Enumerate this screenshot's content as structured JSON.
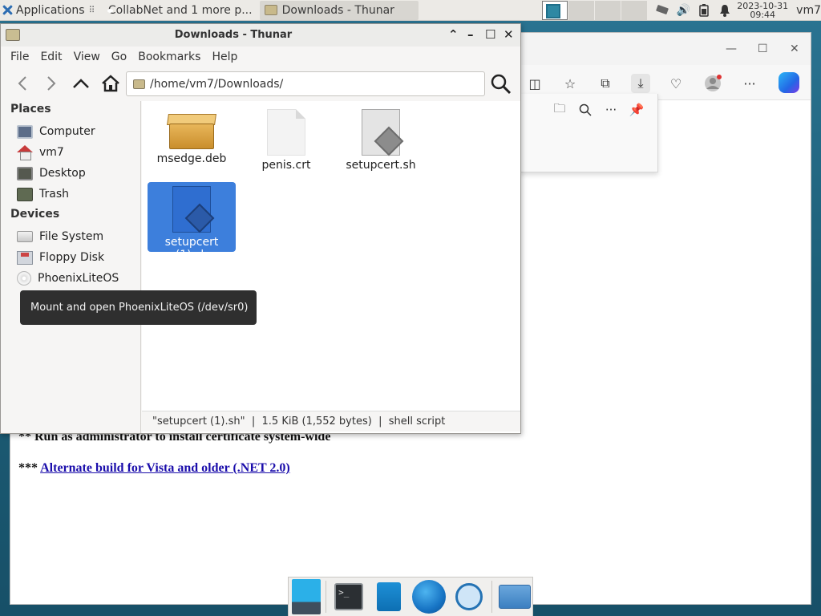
{
  "panel": {
    "applications_label": "Applications",
    "tasks": [
      {
        "label": "CollabNet and 1 more p..."
      },
      {
        "label": "Downloads - Thunar"
      }
    ],
    "clock_date": "2023-10-31",
    "clock_time": "09:44",
    "user": "vm7"
  },
  "thunar": {
    "title": "Downloads - Thunar",
    "menu": [
      "File",
      "Edit",
      "View",
      "Go",
      "Bookmarks",
      "Help"
    ],
    "location": "/home/vm7/Downloads/",
    "sidebar": {
      "places_heading": "Places",
      "places": [
        {
          "label": "Computer",
          "icon": "computer-icon"
        },
        {
          "label": "vm7",
          "icon": "home-icon"
        },
        {
          "label": "Desktop",
          "icon": "desktop-icon"
        },
        {
          "label": "Trash",
          "icon": "trash-icon"
        }
      ],
      "devices_heading": "Devices",
      "devices": [
        {
          "label": "File System",
          "icon": "drive-icon"
        },
        {
          "label": "Floppy Disk",
          "icon": "floppy-icon"
        },
        {
          "label": "PhoenixLiteOS",
          "icon": "disc-icon"
        }
      ]
    },
    "files": [
      {
        "name": "msedge.deb",
        "icon": "package-icon"
      },
      {
        "name": "penis.crt",
        "icon": "document-icon"
      },
      {
        "name": "setupcert.sh",
        "icon": "script-icon"
      },
      {
        "name": "setupcert (1).sh",
        "icon": "script-icon",
        "selected": true
      }
    ],
    "status": "\"setupcert (1).sh\"  |  1.5 KiB (1,552 bytes)  |  shell script",
    "tooltip": "Mount and open PhoenixLiteOS (/dev/sr0)"
  },
  "browser": {
    "line1": "** Run as administrator to install certificate system-wide",
    "line2_prefix": "*** ",
    "line2_link": "Alternate build for Vista and older (.NET 2.0)"
  }
}
